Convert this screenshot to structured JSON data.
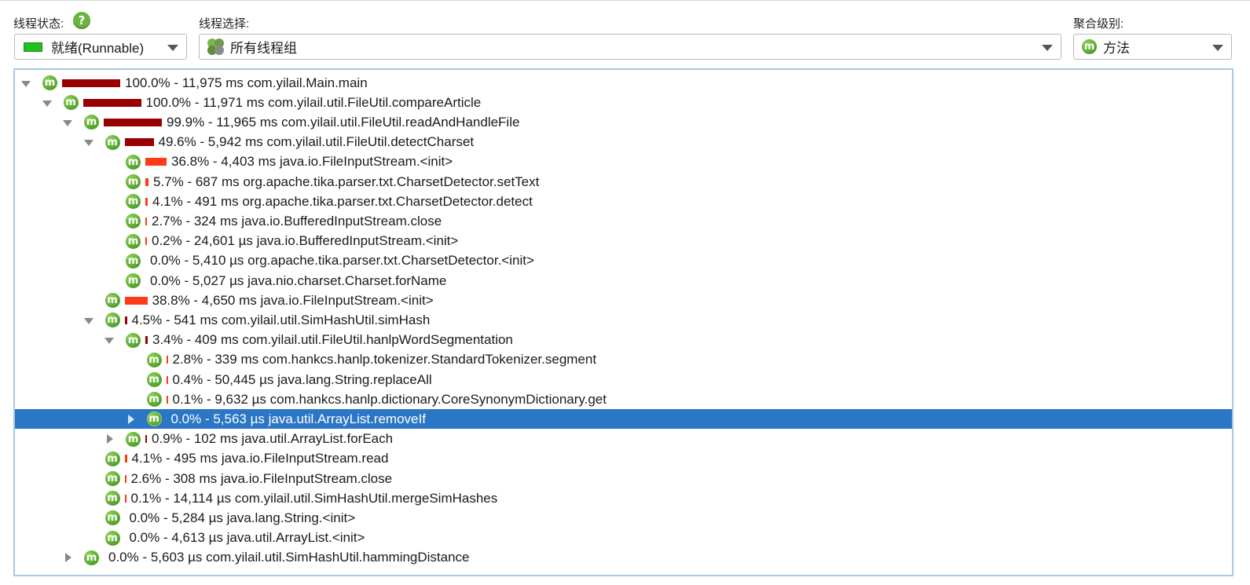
{
  "header": {
    "thread_state_label": "线程状态:",
    "thread_state_value": "就绪(Runnable)",
    "thread_select_label": "线程选择:",
    "thread_select_value": "所有线程组",
    "aggregation_label": "聚合级别:",
    "aggregation_value": "方法",
    "help_glyph": "?"
  },
  "colors": {
    "accent_selected": "#2b76c5",
    "bar_dark": "#990000",
    "bar_bright": "#ff3a17",
    "runnable_swatch": "#1ec21e",
    "method_icon": "#5aa832"
  },
  "tree": {
    "rows": [
      {
        "depth": 0,
        "toggle": "open",
        "marked": false,
        "bar_pct": 100.0,
        "bar_color": "dark",
        "text": "100.0% - 11,975 ms com.yilail.Main.main"
      },
      {
        "depth": 1,
        "toggle": "open",
        "marked": false,
        "bar_pct": 100.0,
        "bar_color": "dark",
        "text": "100.0% - 11,971 ms com.yilail.util.FileUtil.compareArticle"
      },
      {
        "depth": 2,
        "toggle": "open",
        "marked": false,
        "bar_pct": 99.9,
        "bar_color": "dark",
        "text": "99.9% - 11,965 ms com.yilail.util.FileUtil.readAndHandleFile"
      },
      {
        "depth": 3,
        "toggle": "open",
        "marked": false,
        "bar_pct": 49.6,
        "bar_color": "dark",
        "text": "49.6% - 5,942 ms com.yilail.util.FileUtil.detectCharset"
      },
      {
        "depth": 4,
        "toggle": "none",
        "marked": true,
        "bar_pct": 36.8,
        "bar_color": "bright",
        "text": "36.8% - 4,403 ms java.io.FileInputStream.<init>"
      },
      {
        "depth": 4,
        "toggle": "none",
        "marked": false,
        "bar_pct": 5.7,
        "bar_color": "bright",
        "text": "5.7% - 687 ms org.apache.tika.parser.txt.CharsetDetector.setText"
      },
      {
        "depth": 4,
        "toggle": "none",
        "marked": true,
        "bar_pct": 4.1,
        "bar_color": "bright",
        "text": "4.1% - 491 ms org.apache.tika.parser.txt.CharsetDetector.detect"
      },
      {
        "depth": 4,
        "toggle": "none",
        "marked": true,
        "bar_pct": 2.7,
        "bar_color": "bright",
        "text": "2.7% - 324 ms java.io.BufferedInputStream.close"
      },
      {
        "depth": 4,
        "toggle": "none",
        "marked": true,
        "bar_pct": 0.2,
        "bar_color": "bright",
        "text": "0.2% - 24,601 µs java.io.BufferedInputStream.<init>"
      },
      {
        "depth": 4,
        "toggle": "none",
        "marked": false,
        "bar_pct": 0.0,
        "bar_color": "bright",
        "text": "0.0% - 5,410 µs org.apache.tika.parser.txt.CharsetDetector.<init>"
      },
      {
        "depth": 4,
        "toggle": "none",
        "marked": false,
        "bar_pct": 0.0,
        "bar_color": "bright",
        "text": "0.0% - 5,027 µs java.nio.charset.Charset.forName"
      },
      {
        "depth": 3,
        "toggle": "none",
        "marked": true,
        "bar_pct": 38.8,
        "bar_color": "bright",
        "text": "38.8% - 4,650 ms java.io.FileInputStream.<init>"
      },
      {
        "depth": 3,
        "toggle": "open",
        "marked": false,
        "bar_pct": 4.5,
        "bar_color": "dark",
        "text": "4.5% - 541 ms com.yilail.util.SimHashUtil.simHash"
      },
      {
        "depth": 4,
        "toggle": "open",
        "marked": false,
        "bar_pct": 3.4,
        "bar_color": "dark",
        "text": "3.4% - 409 ms com.yilail.util.FileUtil.hanlpWordSegmentation"
      },
      {
        "depth": 5,
        "toggle": "none",
        "marked": true,
        "bar_pct": 2.8,
        "bar_color": "bright",
        "text": "2.8% - 339 ms com.hankcs.hanlp.tokenizer.StandardTokenizer.segment"
      },
      {
        "depth": 5,
        "toggle": "none",
        "marked": false,
        "bar_pct": 0.4,
        "bar_color": "bright",
        "text": "0.4% - 50,445 µs java.lang.String.replaceAll"
      },
      {
        "depth": 5,
        "toggle": "none",
        "marked": true,
        "bar_pct": 0.1,
        "bar_color": "bright",
        "text": "0.1% - 9,632 µs com.hankcs.hanlp.dictionary.CoreSynonymDictionary.get"
      },
      {
        "depth": 5,
        "toggle": "closed",
        "marked": false,
        "bar_pct": 0.0,
        "bar_color": "bright",
        "text": "0.0% - 5,563 µs java.util.ArrayList.removeIf",
        "selected": true
      },
      {
        "depth": 4,
        "toggle": "closed",
        "marked": false,
        "bar_pct": 0.9,
        "bar_color": "dark",
        "text": "0.9% - 102 ms java.util.ArrayList.forEach"
      },
      {
        "depth": 3,
        "toggle": "none",
        "marked": true,
        "bar_pct": 4.1,
        "bar_color": "bright",
        "text": "4.1% - 495 ms java.io.FileInputStream.read"
      },
      {
        "depth": 3,
        "toggle": "none",
        "marked": true,
        "bar_pct": 2.6,
        "bar_color": "bright",
        "text": "2.6% - 308 ms java.io.FileInputStream.close"
      },
      {
        "depth": 3,
        "toggle": "none",
        "marked": false,
        "bar_pct": 0.1,
        "bar_color": "bright",
        "text": "0.1% - 14,114 µs com.yilail.util.SimHashUtil.mergeSimHashes"
      },
      {
        "depth": 3,
        "toggle": "none",
        "marked": true,
        "bar_pct": 0.0,
        "bar_color": "bright",
        "text": "0.0% - 5,284 µs java.lang.String.<init>"
      },
      {
        "depth": 3,
        "toggle": "none",
        "marked": true,
        "bar_pct": 0.0,
        "bar_color": "bright",
        "text": "0.0% - 4,613 µs java.util.ArrayList.<init>"
      },
      {
        "depth": 2,
        "toggle": "closed",
        "marked": false,
        "bar_pct": 0.0,
        "bar_color": "dark",
        "text": "0.0% - 5,603 µs com.yilail.util.SimHashUtil.hammingDistance"
      }
    ]
  }
}
